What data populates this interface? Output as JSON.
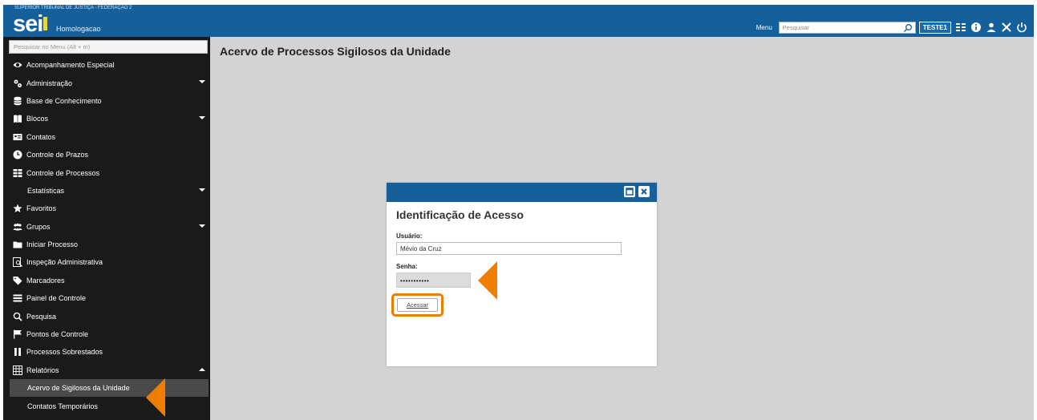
{
  "header": {
    "org": "SUPERIOR TRIBUNAL DE JUSTIÇA - FEDERAÇÃO 2",
    "logo": "sei",
    "environment": "Homologacao",
    "menu_label": "Menu",
    "search_placeholder": "Pesquisar",
    "user_badge": "TESTE1"
  },
  "sidebar": {
    "search_placeholder": "Pesquisar no Menu (Alt + m)",
    "items": [
      {
        "label": "Acompanhamento Especial",
        "icon": "eye-icon"
      },
      {
        "label": "Administração",
        "icon": "gears-icon",
        "expand": "down"
      },
      {
        "label": "Base de Conhecimento",
        "icon": "database-icon"
      },
      {
        "label": "Blocos",
        "icon": "books-icon",
        "expand": "down"
      },
      {
        "label": "Contatos",
        "icon": "contact-card-icon"
      },
      {
        "label": "Controle de Prazos",
        "icon": "clock-icon"
      },
      {
        "label": "Controle de Processos",
        "icon": "grid-icon"
      },
      {
        "label": "Estatísticas",
        "icon": "",
        "expand": "down",
        "sub": true
      },
      {
        "label": "Favoritos",
        "icon": "star-icon"
      },
      {
        "label": "Grupos",
        "icon": "users-icon",
        "expand": "down"
      },
      {
        "label": "Iniciar Processo",
        "icon": "folder-icon"
      },
      {
        "label": "Inspeção Administrativa",
        "icon": "inspect-icon"
      },
      {
        "label": "Marcadores",
        "icon": "tag-icon"
      },
      {
        "label": "Painel de Controle",
        "icon": "panel-icon"
      },
      {
        "label": "Pesquisa",
        "icon": "search-icon"
      },
      {
        "label": "Pontos de Controle",
        "icon": "flag-icon"
      },
      {
        "label": "Processos Sobrestados",
        "icon": "pause-icon"
      },
      {
        "label": "Relatórios",
        "icon": "table-icon",
        "expand": "up"
      },
      {
        "label": "Acervo de Sigilosos da Unidade",
        "icon": "",
        "sub": true,
        "active": true
      },
      {
        "label": "Contatos Temporários",
        "icon": "",
        "sub": true
      }
    ]
  },
  "main": {
    "title": "Acervo de Processos Sigilosos da Unidade"
  },
  "dialog": {
    "title": "Identificação de Acesso",
    "user_label": "Usuário:",
    "user_value": "Mévio da Cruz",
    "password_label": "Senha:",
    "password_value": "•••••••••••",
    "submit_label": "Acessar"
  },
  "colors": {
    "header": "#155f9b",
    "sidebar": "#1a1a1a",
    "highlight": "#ef7d00"
  }
}
